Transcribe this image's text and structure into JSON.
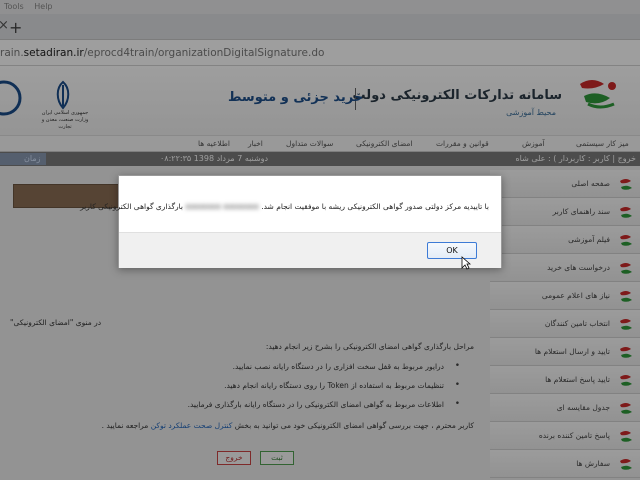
{
  "browser": {
    "menu": [
      "Tools",
      "Help"
    ],
    "url_prefix": "rain.",
    "url_host": "setadiran.ir",
    "url_path": "/eprocd4train/organizationDigitalSignature.do"
  },
  "header": {
    "title": "سامانه تدارکات الکترونیکی دولت",
    "subtitle": "محیط آموزشی",
    "slogan": "خرید جزئی و متوسط",
    "ministry": "جمهوری اسلامی ایران وزارت صنعت، معدن و تجارت"
  },
  "nav": {
    "items": [
      "میز کار سیستمی",
      "آموزش",
      "قوانین و مقررات",
      "امضای الکترونیکی",
      "سوالات متداول",
      "اخبار",
      "اطلاعیه ها"
    ]
  },
  "userbar": {
    "user": "خروج | کاربر : کاربردار ) : علی شاه",
    "date": "دوشنبه 7 مرداد 1398    ۰۸:۲۲:۳۵",
    "chip_label": "زمان"
  },
  "sidebar": {
    "items": [
      "صفحه اصلی",
      "سند راهنمای کاربر",
      "فیلم آموزشی",
      "درخواست های خرید",
      "نیاز های اعلام عمومی",
      "انتخاب تامین کنندگان",
      "تایید و ارسال استعلام ها",
      "تایید پاسخ استعلام ها",
      "جدول مقایسه ای",
      "پاسخ تامین کننده برنده",
      "سفارش ها"
    ]
  },
  "content": {
    "line1": "در منوی \"امضای الکترونیکی\"",
    "line2": "مراحل بارگذاری گواهی امضای الکترونیکی را بشرح زیر انجام دهید:",
    "bullet1": "درایور مربوط به قفل سخت افزاری را در دستگاه رایانه نصب نمایید.",
    "bullet2": "تنظیمات مربوط به استفاده از Token را روی دستگاه رایانه انجام دهید.",
    "bullet3": "اطلاعات مربوط به گواهی امضای الکترونیکی را در دستگاه رایانه بارگذاری فرمایید.",
    "footer_text": "کاربر محترم ، جهت بررسی گواهی امضای الکترونیکی خود می توانید به بخش",
    "footer_link": "کنترل صحت عملکرد توکن",
    "footer_end": "مراجعه نمایید .",
    "register_label": "ثبت",
    "exit_label": "خروج"
  },
  "dialog": {
    "message_start": "با تاییدیه مرکز دولتی صدور گواهی الکترونیکی ریشه با موفقیت انجام شد.",
    "message_blurred": "xxxxxxxx xxxxxxxx",
    "message_end": "بارگذاری گواهی الکترونیکی کاربر",
    "ok_label": "OK"
  }
}
